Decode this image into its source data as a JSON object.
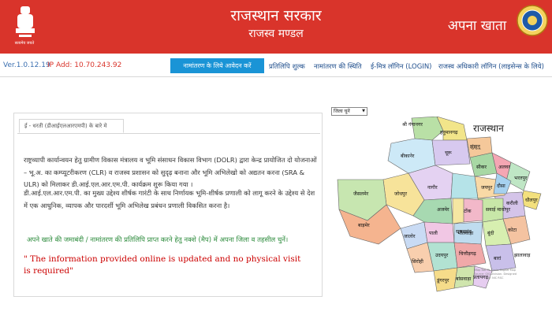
{
  "header": {
    "emblem_caption": "सत्यमेव जयते",
    "title": "राजस्थान सरकार",
    "subtitle": "राजस्व मण्डल",
    "app_name": "अपना खाता",
    "colors": {
      "header_bg": "#d9342b",
      "text": "#ffffff"
    }
  },
  "infobar": {
    "version": "Ver.1.0.12.19",
    "ip": "IP Add: 10.70.243.92"
  },
  "nav": {
    "apply_button": "नामांतरण के लिये आवेदन करें",
    "items": [
      "प्रतिलिपि शुल्क",
      "नामांतरण की स्थिति",
      "ई-मित्र लॉगिन (LOGIN)",
      "राजस्व अधिकारी लॉगिन (लाइसेन्स के लिये)"
    ]
  },
  "content": {
    "tab_label": "ई - धरती (डीआईएलआरएमपी) के बारे मे",
    "paragraph1": "राष्ट्रव्यापी कार्यान्वयन हेतु ग्रामीण विकास मंत्रालय व भूमि संसाधन विकास विभाग (DOLR) द्वारा केन्द्र प्रायोजित दो योजनाओं – भू.अ. का कम्प्यूटरीकरण (CLR) व राजस्व प्रशासन को सुदृढ़ बनाना और भूमि अभिलेखो को अद्यतन करना (SRA & ULR) को मिलाकर डी.आई.एल.आर.एम.पी. कार्यक्रम शुरू किया गया ।",
    "paragraph2": "डी.आई.एल.आर.एम.पी. का मुख्य उद्देश्य शीर्षक गारंटी के साथ निर्णायक भूमि-शीर्षक प्रणाली को लागू करने के उद्देश्य से देश में एक आधुनिक, व्यापक और पारदर्शी भूमि अभिलेख प्रबंधन प्रणाली विकसित करना है।",
    "hint": "अपने खाते की जमाबंदी / नामांतरण की प्रतिलिपि प्राप्त करने हेतु नक्शे (मैप) में अपना जिला व तहसील चुनें।",
    "warning": "\" The information provided online is updated and no physical visit is required\""
  },
  "map": {
    "select_value": "जिला चुनें",
    "title": "राजस्थान",
    "credit": "Map Not To Scale. Digital Map Source: GIS Division. Designed By: NIC RSC",
    "districts": [
      "श्री गंगानगर",
      "हनुमानगढ़",
      "बीकानेर",
      "चूरू",
      "झुंझुनू",
      "सीकर",
      "अलवर",
      "भरतपुर",
      "धौलपुर",
      "करौली",
      "जयपुर",
      "दौसा",
      "सवाई माधोपुर",
      "टोंक",
      "अजमेर",
      "नागौर",
      "जोधपुर",
      "जैसलमेर",
      "बाड़मेर",
      "जालोर",
      "सिरोही",
      "पाली",
      "राजसमंद",
      "उदयपुर",
      "डूंगरपुर",
      "बांसवाड़ा",
      "प्रतापगढ़",
      "चित्तौड़गढ़",
      "भीलवाड़ा",
      "बूंदी",
      "कोटा",
      "बारां",
      "झालावाड़"
    ]
  }
}
